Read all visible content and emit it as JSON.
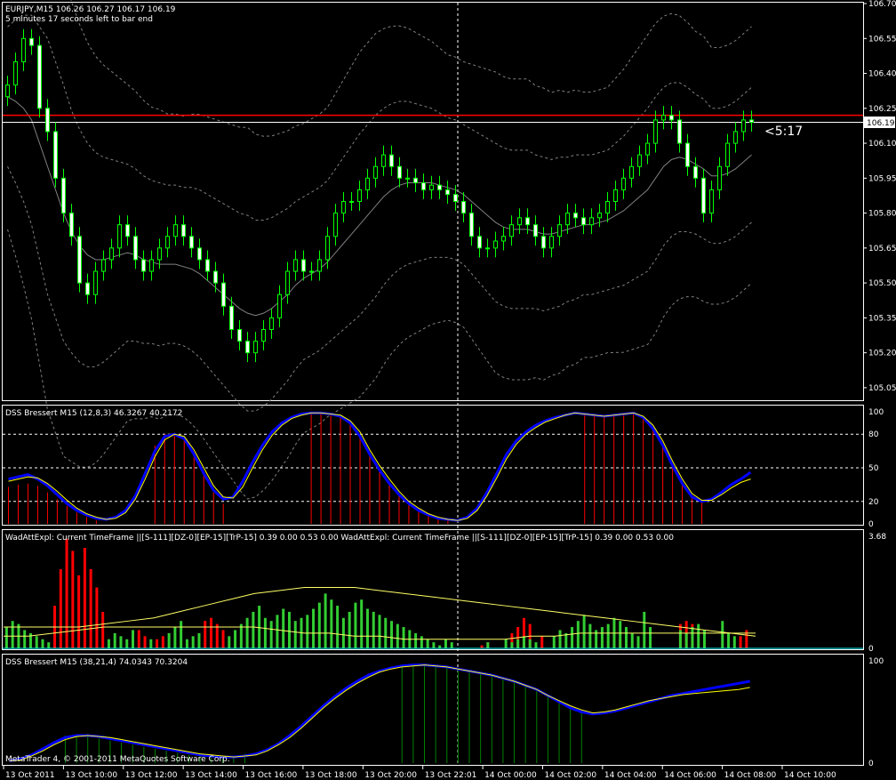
{
  "header": {
    "symbol_line": "EURJPY,M15  106.26 106.27 106.17 106.19",
    "timer_line": "5 minutes 17 seconds left to bar end",
    "countdown": "<5:17"
  },
  "colors": {
    "bull": "#00ff00",
    "bear": "#ffffff",
    "bid_line": "#ff0000",
    "price_badge_bg": "#ffffff",
    "grid": "#ffffff",
    "bands": "#808080",
    "dss_signal": "#ffff00",
    "dss_main": "#0000ff",
    "hist_red": "#ff0000",
    "hist_green": "#32cd32",
    "wad_line": "#ffff66"
  },
  "chart_data": [
    {
      "type": "candlestick",
      "title": "EURJPY,M15",
      "ylim": [
        105.0,
        106.7
      ],
      "yticks": [
        "106.70",
        "106.55",
        "106.40",
        "106.25",
        "106.10",
        "105.95",
        "105.80",
        "105.65",
        "105.50",
        "105.35",
        "105.20",
        "105.05"
      ],
      "current_price": "106.19",
      "bid_level": 106.22,
      "ask_level": 106.19,
      "ohlc_open": [
        106.3,
        106.35,
        106.45,
        106.55,
        106.52,
        106.25,
        106.15,
        105.95,
        105.8,
        105.7,
        105.5,
        105.45,
        105.55,
        105.6,
        105.65,
        105.75,
        105.7,
        105.6,
        105.55,
        105.6,
        105.65,
        105.7,
        105.75,
        105.7,
        105.65,
        105.6,
        105.55,
        105.5,
        105.4,
        105.3,
        105.25,
        105.2,
        105.25,
        105.3,
        105.35,
        105.45,
        105.55,
        105.6,
        105.55,
        105.55,
        105.6,
        105.7,
        105.8,
        105.85,
        105.85,
        105.9,
        105.95,
        106.0,
        106.05,
        106.0,
        105.95,
        105.95,
        105.93,
        105.9,
        105.92,
        105.9,
        105.88,
        105.85,
        105.8,
        105.7,
        105.65,
        105.65,
        105.68,
        105.7,
        105.75,
        105.78,
        105.75,
        105.7,
        105.65,
        105.7,
        105.75,
        105.8,
        105.78,
        105.75,
        105.78,
        105.8,
        105.85,
        105.9,
        105.95,
        106.0,
        106.05,
        106.1,
        106.2,
        106.22,
        106.2,
        106.1,
        106.0,
        105.95,
        105.8,
        105.9,
        106.0,
        106.1,
        106.15,
        106.2
      ],
      "ohlc_close": [
        106.35,
        106.45,
        106.55,
        106.52,
        106.25,
        106.15,
        105.95,
        105.8,
        105.7,
        105.5,
        105.45,
        105.55,
        105.6,
        105.65,
        105.75,
        105.7,
        105.6,
        105.55,
        105.6,
        105.65,
        105.7,
        105.75,
        105.7,
        105.65,
        105.6,
        105.55,
        105.5,
        105.4,
        105.3,
        105.25,
        105.2,
        105.25,
        105.3,
        105.35,
        105.45,
        105.55,
        105.6,
        105.55,
        105.55,
        105.6,
        105.7,
        105.8,
        105.85,
        105.85,
        105.9,
        105.95,
        106.0,
        106.05,
        106.0,
        105.95,
        105.95,
        105.93,
        105.9,
        105.92,
        105.9,
        105.88,
        105.85,
        105.8,
        105.7,
        105.65,
        105.65,
        105.68,
        105.7,
        105.75,
        105.78,
        105.75,
        105.7,
        105.65,
        105.7,
        105.75,
        105.8,
        105.78,
        105.75,
        105.78,
        105.8,
        105.85,
        105.9,
        105.95,
        106.0,
        106.05,
        106.1,
        106.2,
        106.22,
        106.2,
        106.1,
        106.0,
        105.95,
        105.8,
        105.9,
        106.0,
        106.1,
        106.15,
        106.2,
        106.19
      ],
      "mid_band": [
        106.3,
        106.28,
        106.25,
        106.2,
        106.1,
        106.0,
        105.9,
        105.8,
        105.72,
        105.66,
        105.62,
        105.6,
        105.6,
        105.61,
        105.62,
        105.63,
        105.62,
        105.6,
        105.59,
        105.58,
        105.58,
        105.58,
        105.57,
        105.56,
        105.54,
        105.51,
        105.48,
        105.45,
        105.42,
        105.39,
        105.37,
        105.36,
        105.37,
        105.39,
        105.42,
        105.45,
        105.49,
        105.52,
        105.54,
        105.56,
        105.59,
        105.63,
        105.67,
        105.71,
        105.75,
        105.79,
        105.83,
        105.87,
        105.9,
        105.92,
        105.93,
        105.93,
        105.93,
        105.93,
        105.92,
        105.91,
        105.9,
        105.88,
        105.85,
        105.82,
        105.79,
        105.76,
        105.74,
        105.73,
        105.73,
        105.73,
        105.72,
        105.71,
        105.71,
        105.72,
        105.73,
        105.74,
        105.75,
        105.75,
        105.76,
        105.77,
        105.79,
        105.81,
        105.84,
        105.87,
        105.9,
        105.95,
        106.0,
        106.03,
        106.04,
        106.03,
        106.01,
        105.99,
        105.96,
        105.96,
        105.97,
        105.99,
        106.02,
        106.05
      ],
      "band_width": [
        0.3,
        0.35,
        0.4,
        0.45,
        0.5,
        0.55,
        0.55,
        0.55,
        0.52,
        0.5,
        0.48,
        0.46,
        0.44,
        0.42,
        0.4,
        0.38,
        0.37,
        0.36,
        0.35,
        0.35,
        0.34,
        0.34,
        0.34,
        0.35,
        0.36,
        0.37,
        0.38,
        0.39,
        0.4,
        0.41,
        0.42,
        0.41,
        0.4,
        0.39,
        0.38,
        0.37,
        0.36,
        0.35,
        0.35,
        0.35,
        0.35,
        0.36,
        0.37,
        0.38,
        0.39,
        0.39,
        0.39,
        0.38,
        0.37,
        0.36,
        0.35,
        0.34,
        0.33,
        0.32,
        0.31,
        0.3,
        0.3,
        0.3,
        0.31,
        0.32,
        0.33,
        0.34,
        0.34,
        0.34,
        0.34,
        0.34,
        0.33,
        0.33,
        0.32,
        0.32,
        0.31,
        0.31,
        0.3,
        0.3,
        0.3,
        0.3,
        0.31,
        0.32,
        0.33,
        0.34,
        0.35,
        0.35,
        0.34,
        0.33,
        0.32,
        0.31,
        0.3,
        0.3,
        0.29,
        0.29,
        0.29,
        0.29,
        0.29,
        0.29
      ]
    },
    {
      "type": "line",
      "title": "DSS Bressert M15 (12,8,3) 46.3267 40.2172",
      "ylim": [
        0,
        100
      ],
      "yticks": [
        "100",
        "80",
        "50",
        "20",
        "0"
      ],
      "grid_levels": [
        80,
        50,
        20
      ],
      "series": [
        {
          "values": [
            40,
            42,
            44,
            40,
            34,
            26,
            18,
            12,
            8,
            5,
            4,
            6,
            12,
            25,
            45,
            65,
            78,
            80,
            76,
            62,
            45,
            30,
            22,
            24,
            38,
            55,
            70,
            82,
            90,
            95,
            98,
            99,
            99,
            98,
            96,
            90,
            78,
            62,
            48,
            36,
            26,
            18,
            12,
            8,
            5,
            4,
            3,
            6,
            14,
            28,
            45,
            62,
            74,
            82,
            88,
            92,
            95,
            97,
            99,
            98,
            97,
            96,
            97,
            98,
            99,
            95,
            85,
            70,
            52,
            36,
            24,
            20,
            22,
            28,
            35,
            40,
            46
          ]
        },
        {
          "values": [
            38,
            40,
            42,
            41,
            36,
            29,
            21,
            14,
            9,
            6,
            4,
            5,
            10,
            22,
            40,
            60,
            75,
            80,
            78,
            66,
            50,
            34,
            24,
            23,
            33,
            50,
            66,
            79,
            88,
            94,
            97,
            99,
            99,
            98,
            97,
            92,
            82,
            66,
            52,
            40,
            29,
            20,
            14,
            9,
            6,
            4,
            3,
            5,
            12,
            25,
            41,
            58,
            71,
            80,
            86,
            91,
            94,
            97,
            99,
            98,
            97,
            96,
            97,
            98,
            99,
            96,
            88,
            74,
            56,
            40,
            27,
            21,
            21,
            26,
            32,
            37,
            40
          ]
        }
      ],
      "histogram": [
        33,
        35,
        36,
        34,
        28,
        22,
        16,
        10,
        6,
        3,
        0,
        0,
        0,
        0,
        0,
        70,
        80,
        80,
        76,
        62,
        44,
        28,
        18,
        0,
        0,
        0,
        0,
        0,
        0,
        0,
        0,
        98,
        99,
        98,
        96,
        90,
        78,
        62,
        48,
        36,
        26,
        18,
        12,
        8,
        5,
        4,
        0,
        0,
        0,
        0,
        0,
        0,
        0,
        0,
        0,
        0,
        0,
        0,
        0,
        98,
        97,
        96,
        97,
        98,
        99,
        95,
        85,
        70,
        52,
        36,
        24,
        20,
        0,
        0,
        0,
        0,
        0
      ]
    },
    {
      "type": "bar",
      "title": "WadAttExpl: Current TimeFrame ||[S-111][DZ-0][EP-15][TrP-15] 0.39 0.00 0.53 0.00  WadAttExpl: Current TimeFrame ||[S-111][DZ-0][EP-15][TrP-15] 0.39 0.00 0.53 0.00",
      "ylim": [
        0,
        3.68
      ],
      "yticks": [
        "3.68",
        "0"
      ],
      "red_bars": [
        0,
        0,
        0,
        0,
        0,
        0,
        0,
        0,
        1.4,
        2.6,
        3.6,
        3.2,
        2.4,
        3.3,
        2.6,
        2.0,
        1.2,
        0,
        0,
        0,
        0,
        0,
        0.6,
        0.4,
        0,
        0.3,
        0.4,
        0,
        0,
        0,
        0,
        0,
        0,
        0.9,
        1.0,
        0.8,
        0.6,
        0,
        0,
        0,
        0,
        0,
        0,
        0,
        0,
        0,
        0,
        0,
        0,
        0,
        0,
        0,
        0,
        0,
        0,
        0,
        0,
        0,
        0,
        0,
        0,
        0,
        0,
        0,
        0,
        0,
        0,
        0,
        0,
        0,
        0,
        0,
        0,
        0,
        0,
        0,
        0,
        0,
        0,
        0.1,
        0.2,
        0,
        0,
        0,
        0.5,
        0.7,
        1.0,
        0.8,
        0,
        0.4,
        0,
        0,
        0.6,
        0,
        0,
        0,
        0,
        0,
        0,
        0,
        0,
        0.9,
        0.3,
        0,
        0,
        0,
        0,
        0,
        0,
        0,
        0,
        0,
        0.8,
        0.9,
        0.8,
        0,
        0,
        0,
        0,
        0,
        0,
        0,
        0.4,
        0.6,
        0
      ],
      "green_bars": [
        0.7,
        0.9,
        0.8,
        0.6,
        0.5,
        0.4,
        0.3,
        0.2,
        0,
        0,
        0,
        0,
        0,
        0,
        0,
        0,
        0,
        0.3,
        0.5,
        0.4,
        0.3,
        0.6,
        0,
        0,
        0.3,
        0,
        0,
        0.5,
        0.7,
        0.9,
        0.3,
        0.4,
        0.5,
        0,
        0,
        0,
        0,
        0.4,
        0.6,
        0.8,
        1.0,
        1.2,
        1.4,
        1.0,
        0.9,
        1.1,
        1.3,
        1.2,
        0.9,
        1.0,
        1.1,
        1.3,
        1.5,
        1.8,
        1.6,
        1.4,
        1.0,
        1.2,
        1.5,
        1.6,
        1.3,
        1.2,
        1.1,
        1.0,
        0.9,
        0.8,
        0.7,
        0.6,
        0.5,
        0.4,
        0.3,
        0.2,
        0.1,
        0.3,
        0.2,
        0,
        0,
        0,
        0,
        0,
        0.2,
        0,
        0,
        0.3,
        0.2,
        0.3,
        0.4,
        0.3,
        0.2,
        0,
        0,
        0.4,
        0.6,
        0.5,
        0.7,
        0.9,
        1.1,
        0.8,
        0.6,
        0.7,
        0.8,
        1.0,
        0.9,
        0.7,
        0.5,
        0.4,
        1.2,
        0.7,
        0,
        0,
        0,
        0,
        0.6,
        0.5,
        0.7,
        0.8,
        0.6,
        0,
        0,
        0.9,
        0.5,
        0.4
      ],
      "line1": [
        0.7,
        0.7,
        0.7,
        0.7,
        0.8,
        0.9,
        1.0,
        1.2,
        1.4,
        1.6,
        1.8,
        1.9,
        2.0,
        2.0,
        2.0,
        1.9,
        1.8,
        1.7,
        1.6,
        1.5,
        1.4,
        1.3,
        1.2,
        1.1,
        1.0,
        0.9,
        0.8,
        0.7,
        0.6,
        0.5,
        0.4
      ],
      "line2": [
        0.4,
        0.4,
        0.5,
        0.6,
        0.7,
        0.7,
        0.7,
        0.7,
        0.7,
        0.7,
        0.7,
        0.6,
        0.5,
        0.5,
        0.4,
        0.4,
        0.3,
        0.3,
        0.3,
        0.3,
        0.3,
        0.4,
        0.4,
        0.5,
        0.5,
        0.5,
        0.5,
        0.5,
        0.5,
        0.5,
        0.5
      ]
    },
    {
      "type": "line",
      "title": "DSS Bressert M15 (38,21,4) 74.0343 70.3204",
      "ylim": [
        0,
        100
      ],
      "yticks": [
        "100",
        "0"
      ],
      "series": [
        {
          "values": [
            2,
            4,
            8,
            14,
            20,
            25,
            27,
            27,
            26,
            24,
            22,
            20,
            18,
            16,
            14,
            12,
            10,
            8,
            7,
            6,
            6,
            7,
            9,
            13,
            19,
            27,
            36,
            46,
            56,
            65,
            73,
            80,
            86,
            90,
            93,
            95,
            96,
            96,
            95,
            94,
            92,
            90,
            88,
            86,
            83,
            80,
            76,
            72,
            66,
            60,
            54,
            50,
            48,
            49,
            51,
            54,
            57,
            60,
            63,
            66,
            68,
            70,
            72,
            74,
            76,
            78,
            80
          ]
        },
        {
          "values": [
            2,
            3,
            7,
            12,
            18,
            23,
            26,
            27,
            26,
            25,
            23,
            21,
            19,
            17,
            15,
            13,
            11,
            9,
            8,
            7,
            6,
            7,
            8,
            12,
            18,
            25,
            34,
            44,
            54,
            63,
            71,
            78,
            84,
            89,
            92,
            94,
            95,
            96,
            95,
            94,
            92,
            90,
            88,
            86,
            83,
            80,
            76,
            72,
            66,
            61,
            56,
            52,
            49,
            50,
            52,
            55,
            58,
            61,
            63,
            65,
            67,
            68,
            69,
            70,
            71,
            72,
            74
          ]
        }
      ],
      "histogram": [
        0,
        0,
        0,
        0,
        0,
        27,
        27,
        26,
        24,
        22,
        20,
        18,
        16,
        14,
        12,
        10,
        8,
        7,
        6,
        6,
        7,
        9,
        0,
        0,
        0,
        0,
        0,
        0,
        0,
        0,
        0,
        0,
        0,
        0,
        0,
        95,
        96,
        96,
        95,
        94,
        92,
        90,
        88,
        86,
        83,
        80,
        76,
        72,
        66,
        60,
        54,
        50,
        0,
        0,
        0,
        0,
        0,
        0,
        0,
        0,
        0,
        0,
        0,
        0,
        0,
        0,
        0
      ]
    }
  ],
  "time_axis": [
    "13 Oct 2011",
    "13 Oct 10:00",
    "13 Oct 12:00",
    "13 Oct 14:00",
    "13 Oct 16:00",
    "13 Oct 18:00",
    "13 Oct 20:00",
    "13 Oct 22:01",
    "14 Oct 00:00",
    "14 Oct 02:00",
    "14 Oct 04:00",
    "14 Oct 06:00",
    "14 Oct 08:00",
    "14 Oct 10:00"
  ],
  "footer": "MetaTrader 4, © 2001-2011 MetaQuotes Software Corp."
}
